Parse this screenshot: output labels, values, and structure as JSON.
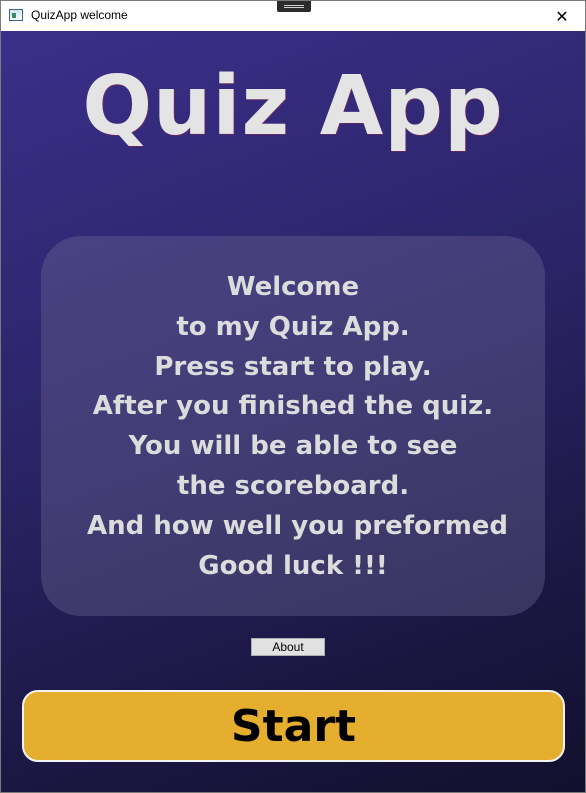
{
  "window": {
    "title": "QuizApp welcome",
    "close_glyph": "✕"
  },
  "main": {
    "app_title": "Quiz App",
    "welcome_lines": [
      "Welcome",
      "to my Quiz App.",
      "Press start to play.",
      "After you finished the quiz.",
      "You will be able to see",
      "the scoreboard.",
      " And how well you preformed",
      "Good luck !!!"
    ],
    "about_label": "About",
    "start_label": "Start"
  },
  "colors": {
    "background_top": "#3b2f8a",
    "background_bottom": "#120f2e",
    "title_text": "#e4e4e4",
    "start_button": "#e6ae2e"
  },
  "icons": {
    "app_icon": "window-app-icon",
    "close_icon": "close-icon"
  }
}
